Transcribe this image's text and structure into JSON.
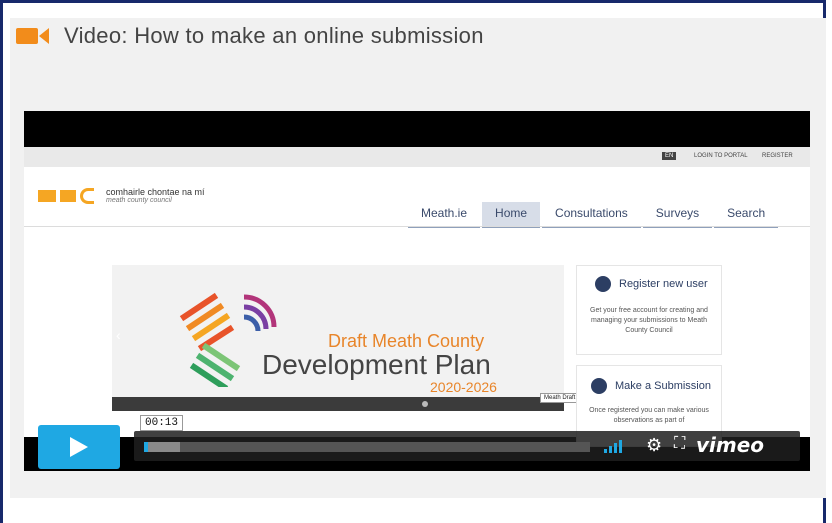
{
  "header": {
    "title": "Video: How to make an online submission",
    "icon": "video-camera-icon",
    "icon_color": "#f28c1b"
  },
  "site": {
    "top_links": {
      "lang": "EN",
      "login": "LOGIN TO PORTAL",
      "register": "REGISTER"
    },
    "logo": {
      "main": "comhairle chontae na mí",
      "sub": "meath county council"
    },
    "nav": [
      "Meath.ie",
      "Home",
      "Consultations",
      "Surveys",
      "Search"
    ],
    "banner": {
      "line1": "Draft Meath County",
      "line2": "Development Plan",
      "line3": "2020-2026",
      "tooltip": "Meath Draft County Development Plan"
    },
    "sidebar": [
      {
        "heading": "Register new user",
        "text": "Get your free account for creating and managing your submissions to Meath County Council"
      },
      {
        "heading": "Make a Submission",
        "text": "Once registered you can make various observations as part of"
      }
    ]
  },
  "player": {
    "time": "00:13",
    "brand": "vimeo",
    "progress": 0.01,
    "buffered": 0.08,
    "accent": "#1fa8e3"
  }
}
